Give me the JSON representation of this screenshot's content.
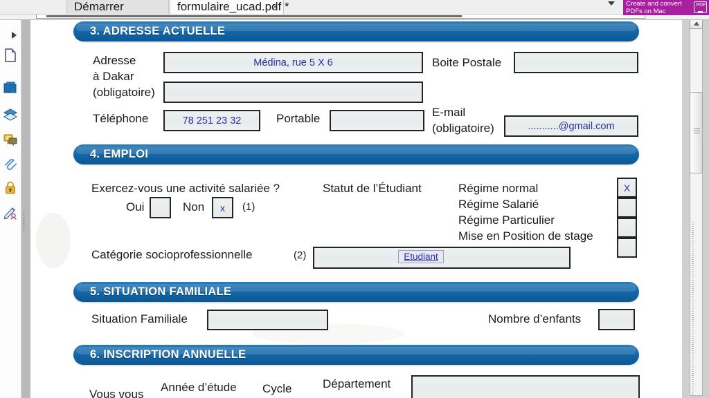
{
  "window": {
    "tabs": [
      {
        "label": "Démarrer",
        "active": false,
        "closable": false
      },
      {
        "label": "formulaire_ucad.pdf *",
        "active": true,
        "closable": true,
        "close_label": "×"
      }
    ]
  },
  "promo": {
    "line1": "Create and convert",
    "line2": "PDFs on Mac",
    "icon": "monitor-pdf-icon",
    "icon_glyph": "PDF",
    "background": "#a81fa0"
  },
  "sidebar": {
    "toggle": "expand-arrow",
    "items": [
      {
        "name": "page-thumbnail-icon",
        "label": "Page thumbnails"
      },
      {
        "name": "pages-icon",
        "label": "Pages"
      },
      {
        "name": "layers-icon",
        "label": "Layers"
      },
      {
        "name": "comments-icon",
        "label": "Comments"
      },
      {
        "name": "attachment-clip-icon",
        "label": "Attachments"
      },
      {
        "name": "lock-icon",
        "label": "Security"
      },
      {
        "name": "signature-icon",
        "label": "Signatures"
      }
    ]
  },
  "document": {
    "title": "formulaire_ucad.pdf",
    "accent_blue": "#1668a8",
    "ink_blue": "#2731a8",
    "sections": [
      {
        "id": "sec3",
        "title": "3. ADRESSE ACTUELLE"
      },
      {
        "id": "sec4",
        "title": "4. EMPLOI"
      },
      {
        "id": "sec5",
        "title": "5. SITUATION FAMILIALE"
      },
      {
        "id": "sec6",
        "title": "6. INSCRIPTION ANNUELLE"
      }
    ],
    "section3": {
      "address_label_l1": "Adresse",
      "address_label_l2": "à Dakar",
      "address_label_l3": "(obligatoire)",
      "address_line1_value": "Médina, rue 5 X 6",
      "address_line2_value": "",
      "boite_postale_label": "Boite Postale",
      "boite_postale_value": "",
      "telephone_label": "Téléphone",
      "telephone_value": "78 251 23 32",
      "portable_label": "Portable",
      "portable_value": "",
      "email_label_l1": "E-mail",
      "email_label_l2": "(obligatoire)",
      "email_value": "...........@gmail.com"
    },
    "section4": {
      "question": "Exercez-vous une activité salariée ?",
      "oui_label": "Oui",
      "oui_value": "",
      "non_label": "Non",
      "non_value": "x",
      "footnote1": "(1)",
      "statut_label": "Statut de l’Étudiant",
      "regimes": [
        {
          "label": "Régime normal",
          "value": "X"
        },
        {
          "label": "Régime Salarié",
          "value": ""
        },
        {
          "label": "Régime Particulier",
          "value": ""
        },
        {
          "label": "Mise en Position de stage",
          "value": ""
        }
      ],
      "categorie_label": "Catégorie socioprofessionnelle",
      "footnote2": "(2)",
      "categorie_value": "Etudiant"
    },
    "section5": {
      "situation_label": "Situation Familiale",
      "situation_value": "",
      "enfants_label": "Nombre d’enfants",
      "enfants_value": ""
    },
    "section6": {
      "vous_vous_label": "Vous vous",
      "annee_label": "Année d’étude",
      "cycle_label": "Cycle",
      "departement_label": "Département",
      "departement_value": ""
    }
  },
  "scrollbars": {
    "vertical_up_arrow": "scroll-up-arrow",
    "horizontal": "horizontal-scrollbar"
  }
}
